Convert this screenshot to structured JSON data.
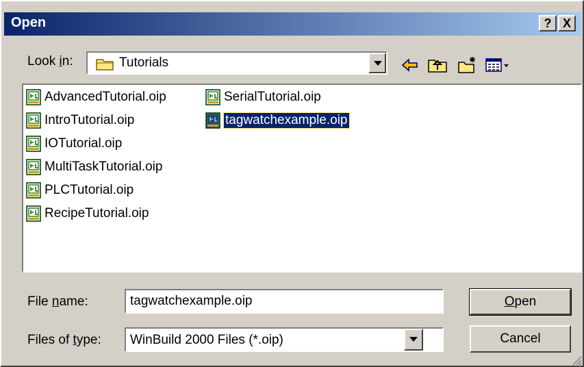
{
  "window": {
    "title": "Open",
    "help_label": "?",
    "close_label": "X"
  },
  "lookin": {
    "label_pre": "Look ",
    "label_key": "i",
    "label_post": "n:",
    "value": "Tutorials"
  },
  "toolbar": {
    "icons": [
      "back-icon",
      "up-folder-icon",
      "new-folder-icon",
      "view-menu-icon"
    ]
  },
  "files": [
    {
      "name": "AdvancedTutorial.oip",
      "selected": false
    },
    {
      "name": "IntroTutorial.oip",
      "selected": false
    },
    {
      "name": "IOTutorial.oip",
      "selected": false
    },
    {
      "name": "MultiTaskTutorial.oip",
      "selected": false
    },
    {
      "name": "PLCTutorial.oip",
      "selected": false
    },
    {
      "name": "RecipeTutorial.oip",
      "selected": false
    },
    {
      "name": "SerialTutorial.oip",
      "selected": false
    },
    {
      "name": "tagwatchexample.oip",
      "selected": true
    }
  ],
  "filename": {
    "label_pre": "File ",
    "label_key": "n",
    "label_post": "ame:",
    "value": "tagwatchexample.oip"
  },
  "filetype": {
    "label_pre": "Files of ",
    "label_key": "t",
    "label_post": "ype:",
    "value": "WinBuild 2000 Files (*.oip)"
  },
  "buttons": {
    "open_key": "O",
    "open_rest": "pen",
    "cancel": "Cancel"
  },
  "colors": {
    "title_start": "#0a246a",
    "title_end": "#a6caf0",
    "face": "#d4d0c8",
    "selection": "#0a246a"
  }
}
